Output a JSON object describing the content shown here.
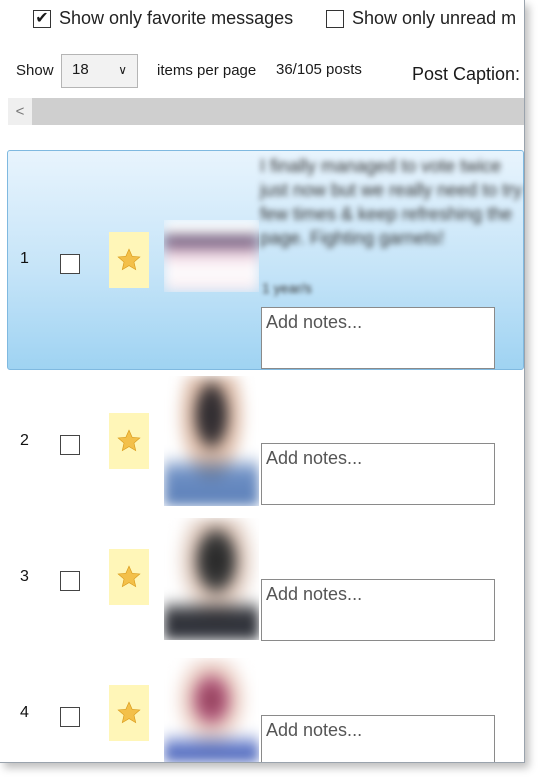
{
  "filters": {
    "favorites_label": "Show only favorite messages",
    "favorites_checked": true,
    "unread_label": "Show only unread m",
    "unread_checked": false
  },
  "pager": {
    "show_label": "Show",
    "per_page_value": "18",
    "per_page_suffix": "items per page",
    "post_count": "36/105 posts",
    "caption_label": "Post Caption:"
  },
  "scrollbar": {
    "left_glyph": "<"
  },
  "colors": {
    "selected_row": "#c5e4f8",
    "favorite_bg": "#fff6b8",
    "star": "#f3c04a"
  },
  "posts": [
    {
      "index": "1",
      "checked": false,
      "favorite": true,
      "icon": "star-icon",
      "text": "I finally managed to vote twice just now but we really need to try few times & keep refreshing the page. Fighting garnets!",
      "time": "1 year/s",
      "notes_placeholder": "Add notes..."
    },
    {
      "index": "2",
      "checked": false,
      "favorite": true,
      "icon": "star-icon",
      "notes_placeholder": "Add notes..."
    },
    {
      "index": "3",
      "checked": false,
      "favorite": true,
      "icon": "star-icon",
      "notes_placeholder": "Add notes..."
    },
    {
      "index": "4",
      "checked": false,
      "favorite": true,
      "icon": "star-icon",
      "notes_placeholder": "Add notes..."
    }
  ]
}
